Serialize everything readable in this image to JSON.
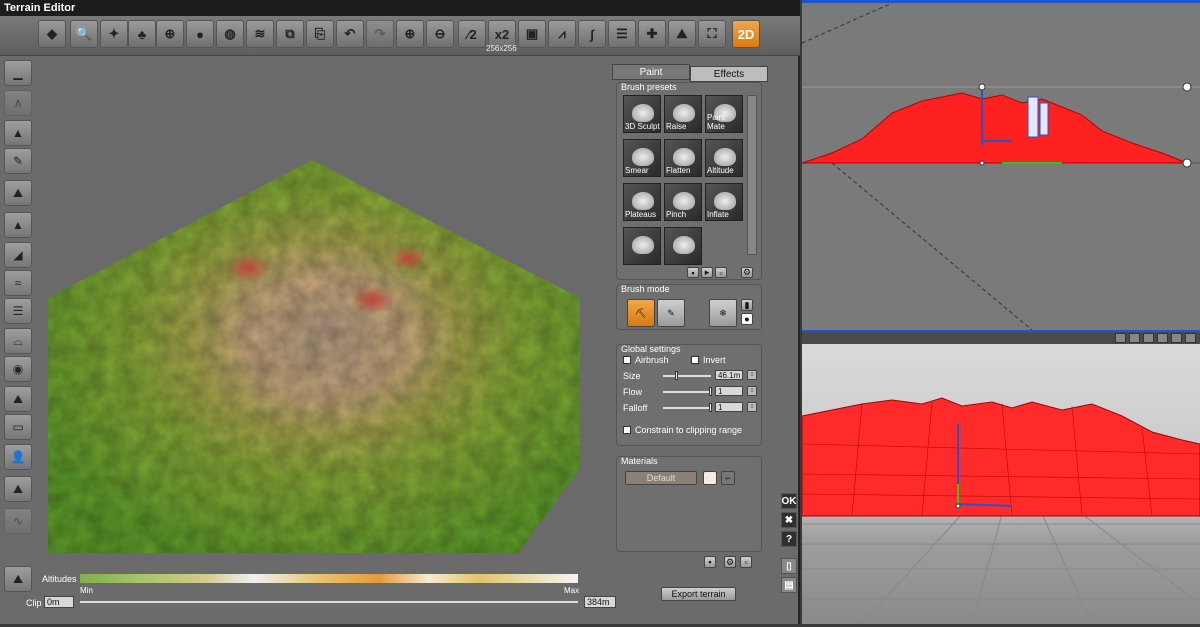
{
  "window": {
    "title": "Terrain Editor"
  },
  "toolbar": {
    "resolution_label": "256x256",
    "buttons": [
      {
        "name": "terrain-type-dropdown",
        "glyph": "◆"
      },
      {
        "name": "zoom-region-icon",
        "glyph": "🔍"
      },
      {
        "name": "lighting-icon",
        "glyph": "✦"
      },
      {
        "name": "vegetation-icon",
        "glyph": "♣"
      },
      {
        "name": "globe-icon",
        "glyph": "⊕"
      },
      {
        "name": "sphere-icon",
        "glyph": "●"
      },
      {
        "name": "rock-sphere-icon",
        "glyph": "◍"
      },
      {
        "name": "terrain-layers-icon",
        "glyph": "≋"
      },
      {
        "name": "copy-icon",
        "glyph": "⧉"
      },
      {
        "name": "paste-icon",
        "glyph": "⎘"
      },
      {
        "name": "undo-icon",
        "glyph": "↶"
      },
      {
        "name": "redo-icon",
        "glyph": "↷"
      },
      {
        "name": "zoom-in-icon",
        "glyph": "⊕"
      },
      {
        "name": "zoom-out-icon",
        "glyph": "⊖"
      },
      {
        "name": "half-resolution-button",
        "glyph": "⁄2"
      },
      {
        "name": "double-resolution-button",
        "glyph": "x2"
      },
      {
        "name": "crop-icon",
        "glyph": "▣"
      },
      {
        "name": "filter-icon",
        "glyph": "⩘"
      },
      {
        "name": "curve-icon",
        "glyph": "∫"
      },
      {
        "name": "erosion-settings-icon",
        "glyph": "☰"
      },
      {
        "name": "add-erosion-icon",
        "glyph": "✚"
      },
      {
        "name": "terrain-preview-icon",
        "glyph": "⛰"
      },
      {
        "name": "fullscreen-icon",
        "glyph": "⛶"
      },
      {
        "name": "2d-mode-button",
        "glyph": "2D"
      }
    ]
  },
  "left_tools": [
    "flat-terrain-icon",
    "smooth-terrain-icon",
    "peak-icon",
    "sculpt-brush-icon",
    "hill-icon",
    "mountain-icon",
    "ridge-icon",
    "dunes-icon",
    "terraces-icon",
    "canyon-icon",
    "crater-icon",
    "rocky-icon",
    "plateau-icon",
    "portrait-icon",
    "alpine-icon",
    "eroded-icon"
  ],
  "panel": {
    "tabs": {
      "paint": "Paint",
      "effects": "Effects"
    },
    "brush_presets_title": "Brush presets",
    "presets": [
      "3D Sculpt",
      "Raise",
      "Paint Mate",
      "Smear",
      "Flatten",
      "Altitude",
      "Plateaus",
      "Pinch",
      "Inflate",
      "",
      ""
    ],
    "brush_mode_title": "Brush mode",
    "global_settings_title": "Global settings",
    "airbrush_label": "Airbrush",
    "invert_label": "Invert",
    "size_label": "Size",
    "size_value": "46.1m",
    "flow_label": "Flow",
    "flow_value": "1",
    "falloff_label": "Falloff",
    "falloff_value": "1",
    "constrain_label": "Constrain to clipping range",
    "materials_title": "Materials",
    "default_button": "Default"
  },
  "side_buttons": {
    "ok": "OK",
    "cancel": "✖",
    "help": "?"
  },
  "bottom": {
    "altitudes_label": "Altitudes",
    "min_label": "Min",
    "max_label": "Max",
    "clip_label": "Clip",
    "clip_min": "0m",
    "clip_max": "384m",
    "export_button": "Export terrain"
  },
  "colors": {
    "accent": "#e88a1a",
    "gizmo_red": "#ff2020",
    "viewport_blue": "#2255cc"
  }
}
